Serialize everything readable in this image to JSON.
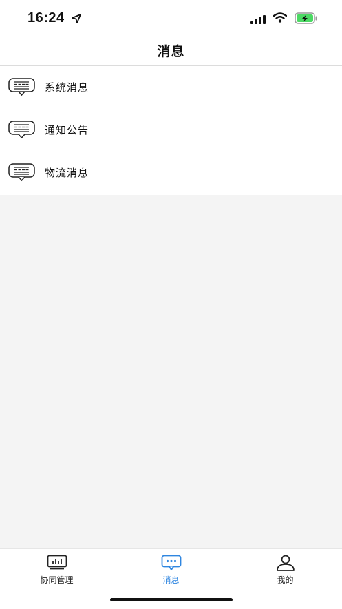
{
  "status_bar": {
    "time": "16:24",
    "icons": [
      "location-arrow-icon",
      "cellular-signal-icon",
      "wifi-icon",
      "battery-charging-icon"
    ],
    "battery_color": "#4cd964"
  },
  "header": {
    "title": "消息"
  },
  "messages": [
    {
      "label": "系统消息",
      "icon": "message-list-icon"
    },
    {
      "label": "通知公告",
      "icon": "message-list-icon"
    },
    {
      "label": "物流消息",
      "icon": "message-list-icon"
    }
  ],
  "tab_bar": {
    "tabs": [
      {
        "label": "协同管理",
        "icon": "chart-monitor-icon",
        "active": false
      },
      {
        "label": "消息",
        "icon": "chat-bubble-icon",
        "active": true
      },
      {
        "label": "我的",
        "icon": "user-profile-icon",
        "active": false
      }
    ],
    "active_color": "#2f86e0"
  }
}
